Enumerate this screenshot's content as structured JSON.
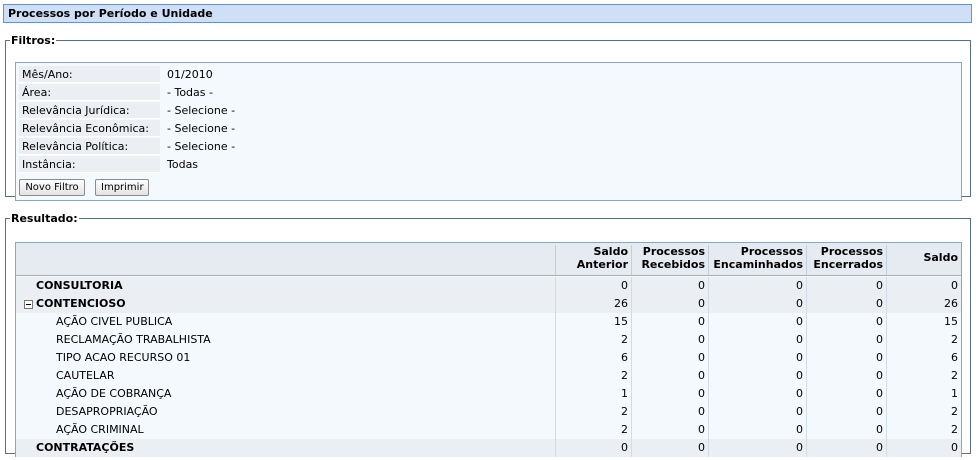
{
  "header": {
    "title": "Processos por Período e Unidade"
  },
  "filters": {
    "legend": "Filtros:",
    "rows": [
      {
        "label": "Mês/Ano:",
        "value": "01/2010"
      },
      {
        "label": "Área:",
        "value": "- Todas -"
      },
      {
        "label": "Relevância Jurídica:",
        "value": "- Selecione -"
      },
      {
        "label": "Relevância Econômica:",
        "value": "- Selecione -"
      },
      {
        "label": "Relevância Política:",
        "value": "- Selecione -"
      },
      {
        "label": "Instância:",
        "value": "Todas"
      }
    ],
    "new_filter_label": "Novo Filtro",
    "print_label": "Imprimir"
  },
  "result": {
    "legend": "Resultado:",
    "columns": {
      "c1a": "Saldo",
      "c1b": "Anterior",
      "c2a": "Processos",
      "c2b": "Recebidos",
      "c3a": "Processos",
      "c3b": "Encaminhados",
      "c4a": "Processos",
      "c4b": "Encerrados",
      "c5": "Saldo"
    },
    "rows": [
      {
        "name": "CONSULTORIA",
        "values": [
          "0",
          "0",
          "0",
          "0",
          "0"
        ]
      },
      {
        "name": "CONTENCIOSO",
        "values": [
          "26",
          "0",
          "0",
          "0",
          "26"
        ]
      },
      {
        "name": "AÇÃO CIVEL PUBLICA",
        "values": [
          "15",
          "0",
          "0",
          "0",
          "15"
        ]
      },
      {
        "name": "RECLAMAÇÃO TRABALHISTA",
        "values": [
          "2",
          "0",
          "0",
          "0",
          "2"
        ]
      },
      {
        "name": "TIPO ACAO RECURSO 01",
        "values": [
          "6",
          "0",
          "0",
          "0",
          "6"
        ]
      },
      {
        "name": "CAUTELAR",
        "values": [
          "2",
          "0",
          "0",
          "0",
          "2"
        ]
      },
      {
        "name": "AÇÃO DE COBRANÇA",
        "values": [
          "1",
          "0",
          "0",
          "0",
          "1"
        ]
      },
      {
        "name": "DESAPROPRIAÇÃO",
        "values": [
          "2",
          "0",
          "0",
          "0",
          "2"
        ]
      },
      {
        "name": "AÇÃO CRIMINAL",
        "values": [
          "2",
          "0",
          "0",
          "0",
          "2"
        ]
      },
      {
        "name": "CONTRATAÇÕES",
        "values": [
          "0",
          "0",
          "0",
          "0",
          "0"
        ]
      }
    ]
  }
}
